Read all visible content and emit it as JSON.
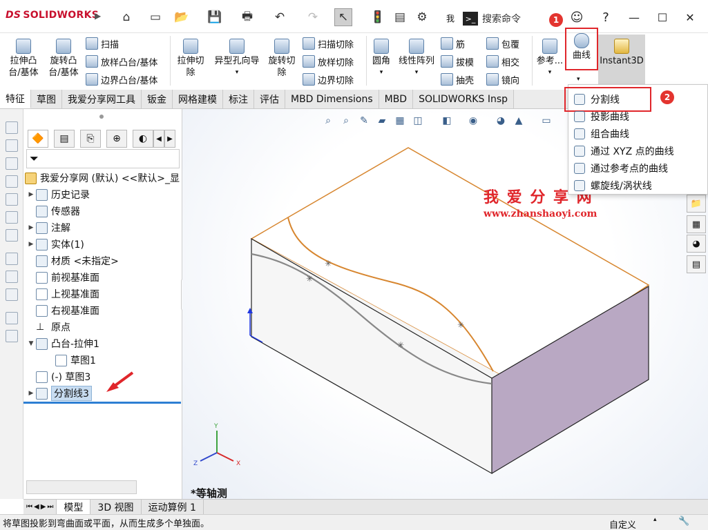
{
  "app": {
    "logo": "SOLIDWORKS",
    "ds": "DS",
    "search_placeholder": "搜索命令",
    "search_prefix": "我"
  },
  "badges": {
    "one": "1",
    "two": "2"
  },
  "ribbon": {
    "extrude_boss": "拉伸凸台/基体",
    "revolve_boss": "旋转凸台/基体",
    "sweep": "扫描",
    "loft_boss": "放样凸台/基体",
    "boundary_boss": "边界凸台/基体",
    "extrude_cut": "拉伸切除",
    "hole_wizard": "异型孔向导",
    "revolve_cut": "旋转切除",
    "sweep_cut": "扫描切除",
    "loft_cut": "放样切除",
    "boundary_cut": "边界切除",
    "fillet": "圆角",
    "linear_pattern": "线性阵列",
    "rib": "筋",
    "draft": "拔模",
    "shell": "抽壳",
    "wrap": "包覆",
    "intersect": "相交",
    "mirror": "镜向",
    "reference": "参考...",
    "curves": "曲线",
    "instant3d": "Instant3D"
  },
  "tabs": [
    "特征",
    "草图",
    "我爱分享网工具",
    "钣金",
    "网格建模",
    "标注",
    "评估",
    "MBD Dimensions",
    "MBD",
    "SOLIDWORKS Insp"
  ],
  "tree": {
    "root": "我爱分享网 (默认) <<默认>_显",
    "history": "历史记录",
    "sensors": "传感器",
    "annotations": "注解",
    "solid_bodies": "实体(1)",
    "material": "材质 <未指定>",
    "front_plane": "前视基准面",
    "top_plane": "上视基准面",
    "right_plane": "右视基准面",
    "origin": "原点",
    "boss_extrude": "凸台-拉伸1",
    "sketch1": "草图1",
    "sketch3": "(-) 草图3",
    "split_line": "分割线3"
  },
  "menu": {
    "items": [
      "分割线",
      "投影曲线",
      "组合曲线",
      "通过 XYZ 点的曲线",
      "通过参考点的曲线",
      "螺旋线/涡状线"
    ]
  },
  "watermark": {
    "title": "我 爱 分 享 网",
    "url": "www.zhanshaoyi.com"
  },
  "viewport": {
    "view_label": "*等轴测",
    "axis_x": "X",
    "axis_y": "Y",
    "axis_z": "Z"
  },
  "bottom_tabs": [
    "模型",
    "3D 视图",
    "运动算例 1"
  ],
  "status": {
    "message": "将草图投影到弯曲面或平面，从而生成多个单独面。",
    "custom": "自定义"
  },
  "colors": {
    "accent": "#e0262b",
    "orange_edge": "#d7862f",
    "side_face": "#b9a8c3"
  }
}
